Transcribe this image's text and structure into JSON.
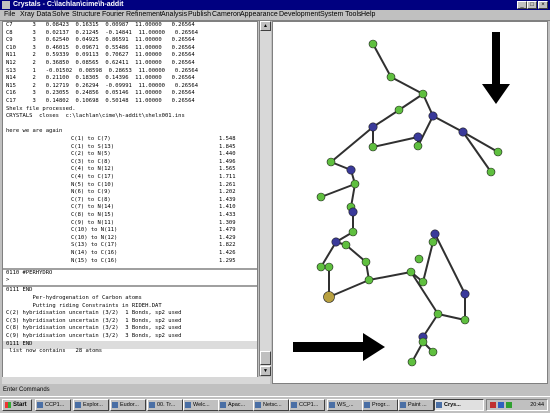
{
  "window": {
    "title": "Crystals - C:\\lachlan\\cime\\h-addit"
  },
  "menu": [
    "File",
    "Xray Data",
    "Solve",
    "Structure",
    "Fourier",
    "Refinement",
    "Analysis",
    "Publish",
    "Cameron",
    "Appearance",
    "Development",
    "System Tools",
    "Help"
  ],
  "atom_rows": [
    "C7      3   0.08423  0.16315  0.00987  11.00000   0.26564",
    "C8      3   0.02137  0.21245  -0.14841  11.00000   0.26564",
    "C9      3   0.62540  0.04925  0.86591  11.00000   0.26564",
    "C10     3   0.46015  0.09671  0.55486  11.00000   0.26564",
    "N11     2   0.59339  0.09113  0.70627  11.00000   0.26564",
    "N12     2   0.36850  0.08565  0.62411  11.00000   0.26564",
    "S13     1   -0.01502  0.08598  0.28653  11.00000   0.26564",
    "N14     2   0.21100  0.18305  0.14396  11.00000   0.26564",
    "N15     2   0.12719  0.26294  -0.09991  11.00000   0.26564",
    "C16     3   0.23055  0.24856  0.05146  11.00000   0.26564",
    "C17     3   0.14802  0.10698  0.50148  11.00000   0.26564"
  ],
  "messages": [
    "Shelx file processed.",
    "CRYSTALS  closes  c:\\lachlan\\cime\\h-addit\\shelx001.ins",
    "",
    "here we are again"
  ],
  "bonds": [
    {
      "pair": "C(1) to C(7)",
      "dist": "1.548"
    },
    {
      "pair": "C(1) to S(13)",
      "dist": "1.845"
    },
    {
      "pair": "C(2) to N(5)",
      "dist": "1.440"
    },
    {
      "pair": "C(3) to C(8)",
      "dist": "1.496"
    },
    {
      "pair": "C(4) to N(12)",
      "dist": "1.565"
    },
    {
      "pair": "C(4) to C(17)",
      "dist": "1.711"
    },
    {
      "pair": "N(5) to C(10)",
      "dist": "1.261"
    },
    {
      "pair": "N(6) to C(9)",
      "dist": "1.202"
    },
    {
      "pair": "C(7) to C(8)",
      "dist": "1.439"
    },
    {
      "pair": "C(7) to N(14)",
      "dist": "1.410"
    },
    {
      "pair": "C(8) to N(15)",
      "dist": "1.433"
    },
    {
      "pair": "C(9) to N(11)",
      "dist": "1.309"
    },
    {
      "pair": "C(10) to N(11)",
      "dist": "1.479"
    },
    {
      "pair": "C(10) to N(12)",
      "dist": "1.429"
    },
    {
      "pair": "S(13) to C(17)",
      "dist": "1.822"
    },
    {
      "pair": "N(14) to C(16)",
      "dist": "1.426"
    },
    {
      "pair": "N(15) to C(16)",
      "dist": "1.295"
    }
  ],
  "log_lines": [
    {
      "text": "0110 #PERHYDRO",
      "style": "sep"
    },
    {
      "text": ">",
      "style": ""
    },
    {
      "text": "0111 END",
      "style": "sep"
    },
    {
      "text": "        Per-hydrogenation of Carbon atoms",
      "style": ""
    },
    {
      "text": "        Putting riding Constraints in RIDEH.DAT",
      "style": ""
    },
    {
      "text": "C(2) hybridisation uncertain (3/2)  1 Bonds, sp2 used",
      "style": ""
    },
    {
      "text": "C(3) hybridisation uncertain (3/2)  1 Bonds, sp2 used",
      "style": ""
    },
    {
      "text": "C(8) hybridisation uncertain (3/2)  3 Bonds, sp2 used",
      "style": ""
    },
    {
      "text": "C(9) hybridisation uncertain (3/2)  3 Bonds, sp2 used",
      "style": ""
    },
    {
      "text": "0111 END",
      "style": "hl"
    },
    {
      "text": " list now contains   28 atoms",
      "style": ""
    }
  ],
  "command_label": "Enter Commands",
  "taskbar": {
    "start": "Start",
    "items": [
      "CCP1...",
      "Explor...",
      "Eudor...",
      "00. Tr...",
      "Welc...",
      "Apac...",
      "Netsc...",
      "CCP1...",
      "WS_...",
      "Progr...",
      "Paint ...",
      "Crys..."
    ],
    "active_index": 11,
    "clock": "20:44"
  },
  "colors": {
    "titlebar": "#000080",
    "carbon": "#5fbf3f",
    "nitrogen": "#3a3a9a",
    "sulfur": "#b8a040",
    "bond": "#303030"
  }
}
